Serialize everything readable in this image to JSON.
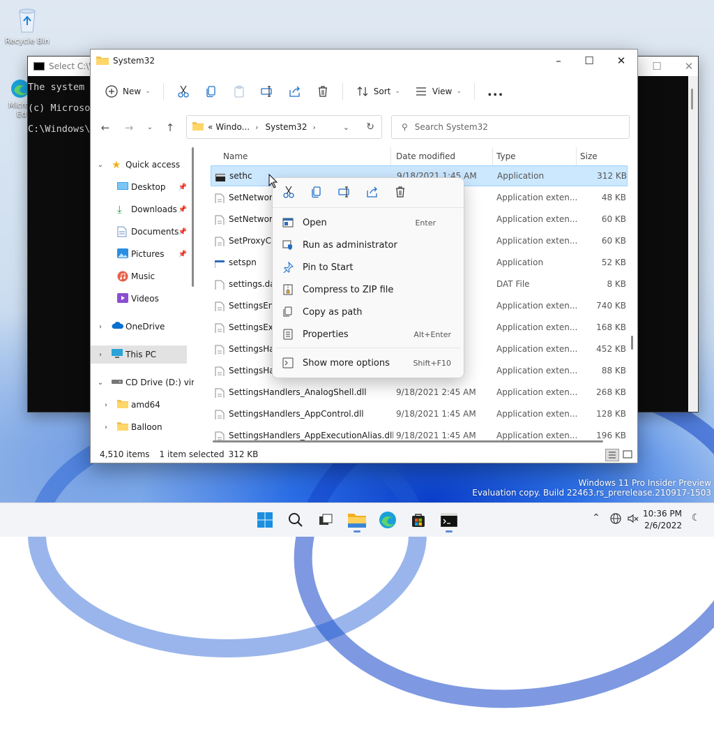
{
  "desktop": {
    "recycle_bin_label": "Recycle Bin",
    "edge_label_1": "Micro",
    "edge_label_2": "Ed",
    "watermark_line1": "Windows 11 Pro Insider Preview",
    "watermark_line2": "Evaluation copy. Build 22463.rs_prerelease.210917-1503"
  },
  "console": {
    "title": "Select C:\\W",
    "lines": [
      "The system c",
      "(c) Microso",
      "C:\\Windows\\"
    ]
  },
  "explorer": {
    "title": "System32",
    "toolbar": {
      "new_label": "New",
      "sort_label": "Sort",
      "view_label": "View",
      "more_label": "..."
    },
    "address": {
      "prefix": "«",
      "crumb1": "Windo...",
      "crumb2": "System32"
    },
    "search_placeholder": "Search System32",
    "nav": [
      {
        "label": "Quick access"
      },
      {
        "label": "Desktop"
      },
      {
        "label": "Downloads"
      },
      {
        "label": "Documents"
      },
      {
        "label": "Pictures"
      },
      {
        "label": "Music"
      },
      {
        "label": "Videos"
      },
      {
        "label": "OneDrive"
      },
      {
        "label": "This PC"
      },
      {
        "label": "CD Drive (D:) virt"
      },
      {
        "label": "amd64"
      },
      {
        "label": "Balloon"
      }
    ],
    "columns": {
      "name": "Name",
      "date": "Date modified",
      "type": "Type",
      "size": "Size"
    },
    "files": [
      {
        "name": "sethc",
        "date": "9/18/2021 1:45 AM",
        "type": "Application",
        "size": "312 KB"
      },
      {
        "name": "SetNetworkL",
        "date": "",
        "type": "Application exten...",
        "size": "48 KB"
      },
      {
        "name": "SetNetworkL",
        "date": "",
        "type": "Application exten...",
        "size": "60 KB"
      },
      {
        "name": "SetProxyCre",
        "date": "",
        "type": "Application exten...",
        "size": "60 KB"
      },
      {
        "name": "setspn",
        "date": "",
        "type": "Application",
        "size": "52 KB"
      },
      {
        "name": "settings.dat",
        "date": "",
        "type": "DAT File",
        "size": "8 KB"
      },
      {
        "name": "SettingsEnvi",
        "date": "",
        "type": "Application exten...",
        "size": "740 KB"
      },
      {
        "name": "SettingsExte",
        "date": "",
        "type": "Application exten...",
        "size": "168 KB"
      },
      {
        "name": "SettingsHan",
        "date": "",
        "type": "Application exten...",
        "size": "452 KB"
      },
      {
        "name": "SettingsHan",
        "date": "",
        "type": "Application exten...",
        "size": "88 KB"
      },
      {
        "name": "SettingsHandlers_AnalogShell.dll",
        "date": "9/18/2021 2:45 AM",
        "type": "Application exten...",
        "size": "268 KB"
      },
      {
        "name": "SettingsHandlers_AppControl.dll",
        "date": "9/18/2021 1:45 AM",
        "type": "Application exten...",
        "size": "128 KB"
      },
      {
        "name": "SettingsHandlers_AppExecutionAlias.dll",
        "date": "9/18/2021 1:45 AM",
        "type": "Application exten...",
        "size": "196 KB"
      }
    ],
    "status": {
      "items": "4,510 items",
      "selected": "1 item selected",
      "size": "312 KB"
    }
  },
  "context_menu": {
    "items": [
      {
        "label": "Open",
        "shortcut": "Enter"
      },
      {
        "label": "Run as administrator",
        "shortcut": ""
      },
      {
        "label": "Pin to Start",
        "shortcut": ""
      },
      {
        "label": "Compress to ZIP file",
        "shortcut": ""
      },
      {
        "label": "Copy as path",
        "shortcut": ""
      },
      {
        "label": "Properties",
        "shortcut": "Alt+Enter"
      },
      {
        "label": "Show more options",
        "shortcut": "Shift+F10"
      }
    ]
  },
  "taskbar": {
    "time": "10:36 PM",
    "date": "2/6/2022"
  },
  "colors": {
    "accent": "#0067c0",
    "selection": "#cce8ff",
    "folder": "#f2c04c"
  }
}
